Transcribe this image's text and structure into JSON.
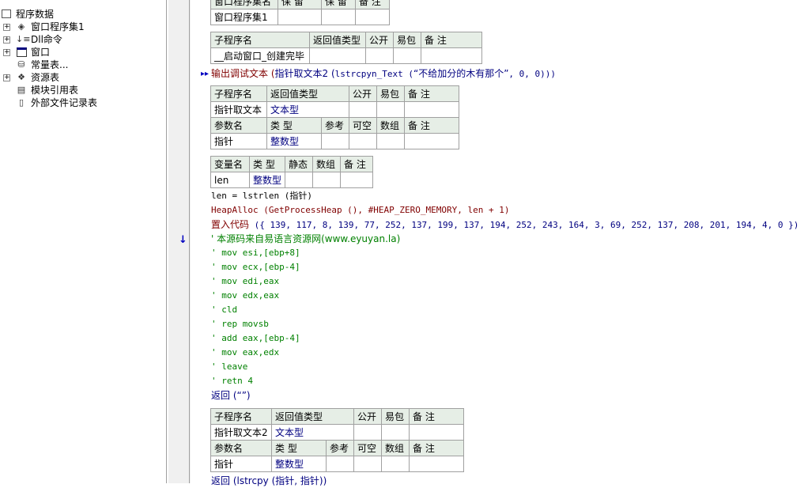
{
  "tree": {
    "root": "程序数据",
    "items": [
      {
        "label": "窗口程序集1",
        "expand": "+",
        "icon": "layers-icon"
      },
      {
        "label": "Dll命令",
        "expand": "+",
        "icon": "dll-icon"
      },
      {
        "label": "窗口",
        "expand": "+",
        "icon": "window-icon"
      },
      {
        "label": "常量表...",
        "expand": "",
        "icon": "database-icon"
      },
      {
        "label": "资源表",
        "expand": "+",
        "icon": "resource-icon"
      },
      {
        "label": "模块引用表",
        "expand": "",
        "icon": "module-icon"
      },
      {
        "label": "外部文件记录表",
        "expand": "",
        "icon": "file-icon"
      }
    ]
  },
  "table0": {
    "headers": [
      "窗口程序集名",
      "保 留",
      "保 留",
      "备 注"
    ],
    "row": [
      "窗口程序集1",
      "",
      "",
      ""
    ]
  },
  "table1": {
    "headers": [
      "子程序名",
      "返回值类型",
      "公开",
      "易包",
      "备 注"
    ],
    "row": [
      "__启动窗口_创建完毕",
      "",
      "",
      "",
      ""
    ]
  },
  "line_debug": {
    "fn": "输出调试文本 (",
    "inner": "指针取文本2 (",
    "call": "lstrcpyn_Text (",
    "str": "“不给加分的木有那个”",
    "rest": ", 0, 0)))"
  },
  "table2": {
    "headers": [
      "子程序名",
      "返回值类型",
      "公开",
      "易包",
      "备 注"
    ],
    "row": [
      "指针取文本",
      "文本型",
      "",
      "",
      ""
    ],
    "param_headers": [
      "参数名",
      "类 型",
      "参考",
      "可空",
      "数组",
      "备 注"
    ],
    "param_row": [
      "指针",
      "整数型",
      "",
      "",
      "",
      ""
    ]
  },
  "table3": {
    "headers": [
      "变量名",
      "类 型",
      "静态",
      "数组",
      "备 注"
    ],
    "row": [
      "len",
      "整数型",
      "",
      "",
      ""
    ]
  },
  "code": {
    "len_line": "len = lstrlen (指针)",
    "heap_line": "HeapAlloc (GetProcessHeap (), #HEAP_ZERO_MEMORY, len + 1)",
    "emit_fn": "置入代码",
    "emit_args": " ({ 139, 117, 8, 139, 77, 252, 137, 199, 137, 194, 252, 243, 164, 3, 69, 252, 137, 208, 201, 194, 4, 0 })",
    "comment_src": "' 本源码来自易语言资源网(www.eyuyan.la)",
    "comments": [
      "' mov esi,[ebp+8]",
      "' mov ecx,[ebp-4]",
      "' mov edi,eax",
      "' mov edx,eax",
      "' cld",
      "' rep movsb",
      "' add eax,[ebp-4]",
      "' mov eax,edx",
      "' leave",
      "' retn 4"
    ],
    "return_line": "返回 (“”)"
  },
  "table4": {
    "headers": [
      "子程序名",
      "返回值类型",
      "公开",
      "易包",
      "备 注"
    ],
    "row": [
      "指针取文本2",
      "文本型",
      "",
      "",
      ""
    ],
    "param_headers": [
      "参数名",
      "类 型",
      "参考",
      "可空",
      "数组",
      "备 注"
    ],
    "param_row": [
      "指针",
      "整数型",
      "",
      "",
      "",
      ""
    ]
  },
  "last_line": "返回 (lstrcpy (指针, 指针))"
}
